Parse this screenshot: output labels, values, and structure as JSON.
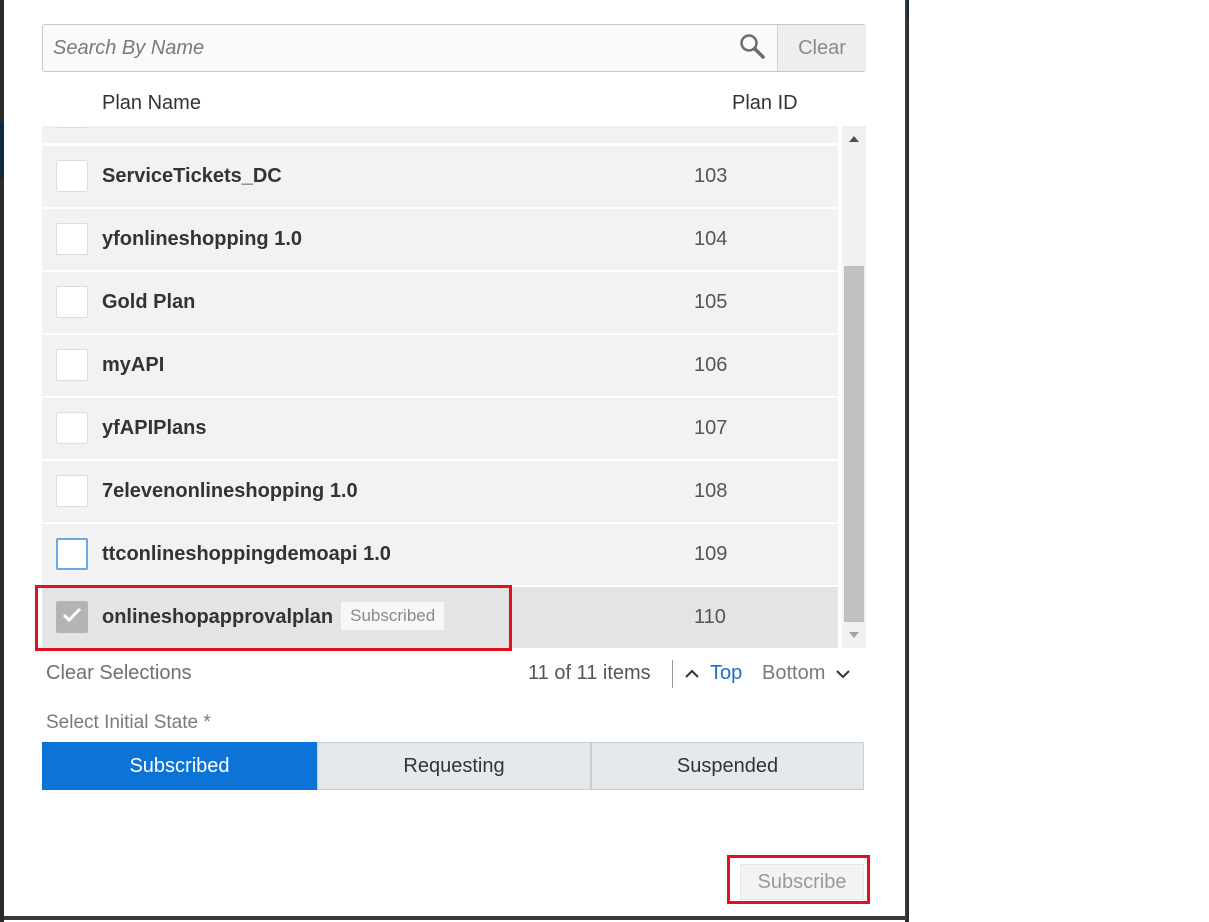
{
  "search": {
    "placeholder": "Search By Name",
    "clear_label": "Clear"
  },
  "table": {
    "headers": {
      "name": "Plan Name",
      "id": "Plan ID"
    },
    "rows": [
      {
        "name": "ServiceTickets_DC",
        "id": "103",
        "checked": false,
        "badge": ""
      },
      {
        "name": "yfonlineshopping 1.0",
        "id": "104",
        "checked": false,
        "badge": ""
      },
      {
        "name": "Gold Plan",
        "id": "105",
        "checked": false,
        "badge": ""
      },
      {
        "name": "myAPI",
        "id": "106",
        "checked": false,
        "badge": ""
      },
      {
        "name": "yfAPIPlans",
        "id": "107",
        "checked": false,
        "badge": ""
      },
      {
        "name": "7elevenonlineshopping 1.0",
        "id": "108",
        "checked": false,
        "badge": ""
      },
      {
        "name": "ttconlineshoppingdemoapi 1.0",
        "id": "109",
        "checked": false,
        "badge": ""
      },
      {
        "name": "onlineshopapprovalplan",
        "id": "110",
        "checked": true,
        "badge": "Subscribed"
      }
    ]
  },
  "footer": {
    "clear_selections": "Clear Selections",
    "count": "11 of 11 items",
    "top": "Top",
    "bottom": "Bottom"
  },
  "initial_state": {
    "label": "Select Initial State *",
    "options": [
      "Subscribed",
      "Requesting",
      "Suspended"
    ],
    "selected": "Subscribed"
  },
  "actions": {
    "subscribe": "Subscribe"
  },
  "colors": {
    "accent": "#0b74d6",
    "highlight": "#e3101f",
    "link": "#1b6fcf"
  },
  "icons": [
    "search-icon",
    "check-icon",
    "chevron-up-icon",
    "chevron-down-icon",
    "scroll-up-arrow-icon",
    "scroll-down-arrow-icon"
  ]
}
